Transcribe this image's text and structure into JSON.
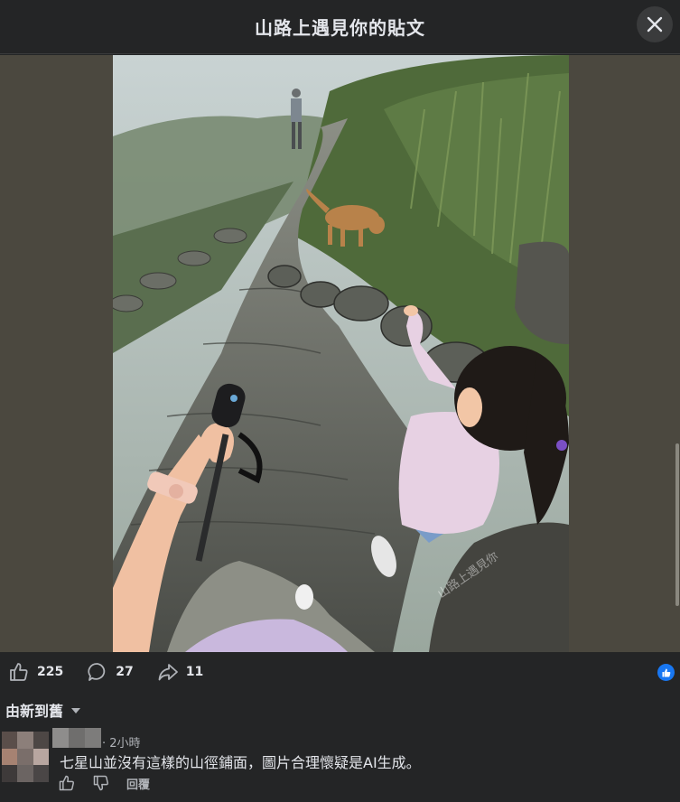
{
  "header": {
    "title": "山路上遇見你的貼文"
  },
  "photo": {
    "watermark": "山路上遇見你"
  },
  "actions": {
    "like_count": "225",
    "comment_count": "27",
    "share_count": "11"
  },
  "sort": {
    "label": "由新到舊"
  },
  "comment": {
    "time": "· 2小時",
    "text": "七星山並沒有這樣的山徑鋪面，圖片合理懷疑是AI生成。",
    "reply_label": "回覆"
  },
  "colors": {
    "background": "#242526",
    "accent": "#1877f2",
    "media_bg": "#4b483f"
  }
}
